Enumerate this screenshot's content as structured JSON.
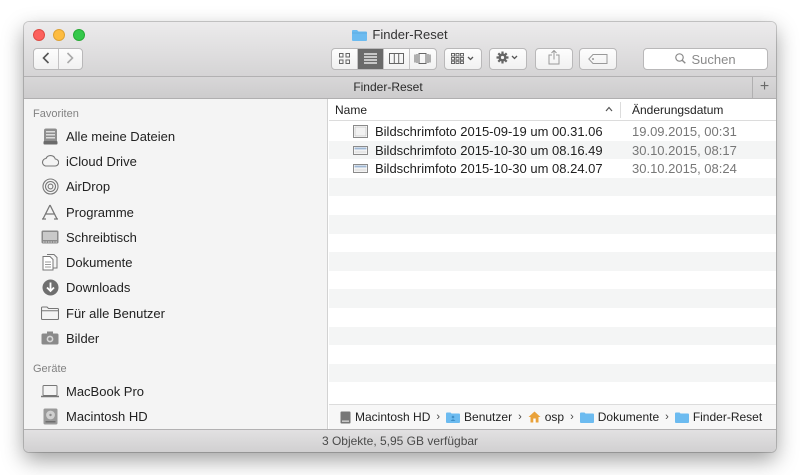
{
  "window": {
    "title": "Finder-Reset"
  },
  "toolbar": {
    "search_placeholder": "Suchen",
    "icons": [
      "chevron-left-icon",
      "chevron-right-icon",
      "icon-view-icon",
      "list-view-icon",
      "column-view-icon",
      "cover-flow-icon",
      "arrange-icon",
      "gear-icon",
      "share-icon",
      "tag-icon",
      "search-icon"
    ]
  },
  "tabbar": {
    "tab_label": "Finder-Reset",
    "add_label": "+"
  },
  "sidebar": {
    "favorites_header": "Favoriten",
    "favorites": [
      {
        "label": "Alle meine Dateien",
        "icon": "all-files-icon"
      },
      {
        "label": "iCloud Drive",
        "icon": "cloud-icon"
      },
      {
        "label": "AirDrop",
        "icon": "airdrop-icon"
      },
      {
        "label": "Programme",
        "icon": "applications-icon"
      },
      {
        "label": "Schreibtisch",
        "icon": "desktop-icon"
      },
      {
        "label": "Dokumente",
        "icon": "documents-icon"
      },
      {
        "label": "Downloads",
        "icon": "downloads-icon"
      },
      {
        "label": "Für alle Benutzer",
        "icon": "folder-icon"
      },
      {
        "label": "Bilder",
        "icon": "camera-icon"
      }
    ],
    "devices_header": "Geräte",
    "devices": [
      {
        "label": "MacBook Pro",
        "icon": "laptop-icon"
      },
      {
        "label": "Macintosh HD",
        "icon": "harddisk-icon"
      }
    ]
  },
  "list": {
    "columns": {
      "name": "Name",
      "date": "Änderungsdatum",
      "sort_indicator": "^"
    },
    "files": [
      {
        "name": "Bildschrimfoto 2015-09-19 um 00.31.06",
        "date": "19.09.2015, 00:31"
      },
      {
        "name": "Bildschrimfoto 2015-10-30 um 08.16.49",
        "date": "30.10.2015, 08:17"
      },
      {
        "name": "Bildschrimfoto 2015-10-30 um 08.24.07",
        "date": "30.10.2015, 08:24"
      }
    ]
  },
  "pathbar": {
    "crumbs": [
      {
        "label": "Macintosh HD",
        "icon": "harddisk-icon"
      },
      {
        "label": "Benutzer",
        "icon": "users-folder-icon"
      },
      {
        "label": "osp",
        "icon": "home-icon"
      },
      {
        "label": "Dokumente",
        "icon": "folder-icon"
      },
      {
        "label": "Finder-Reset",
        "icon": "folder-icon"
      }
    ],
    "separator": "›"
  },
  "status": {
    "text": "3 Objekte, 5,95 GB verfügbar"
  },
  "colors": {
    "folder": "#6cbbf0",
    "accent_active": "#6a6a6a",
    "sidebar_bg": "#f4f4f4"
  }
}
